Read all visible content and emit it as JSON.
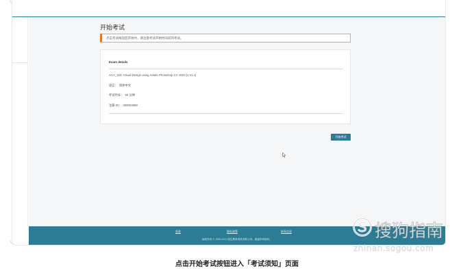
{
  "page": {
    "title": "开始考试",
    "notice": "点击考试按钮后开始时，请注意考试开始时间前的考试。"
  },
  "exam": {
    "heading": "Exam details",
    "name": "ACA_103: Visual Design using Adobe Photoshop CC 2020 (v 21.x)",
    "language_label": "语言：",
    "language_value": "简体中文",
    "duration_label": "考试时长：",
    "duration_value": "50 分钟",
    "registration_label": "注册 ID：",
    "registration_value": "300004980"
  },
  "actions": {
    "start_label": "开始考试"
  },
  "footer": {
    "links": [
      "条款",
      "隐私政策",
      "联系信息"
    ],
    "copyright": "版权所有 © 1996-2021 培生教育或其关联公司。保留所有权利。"
  },
  "watermark": {
    "text": "搜狗指南",
    "subtext": "zhinan.sogou.com"
  },
  "caption": "点击开始考试按钮进入「考试须知」页面",
  "colors": {
    "accent": "#2b7c94",
    "notice_border": "#e07b2a"
  },
  "icons": {
    "cursor": "mouse-pointer",
    "watermark_logo": "sogou-logo"
  }
}
